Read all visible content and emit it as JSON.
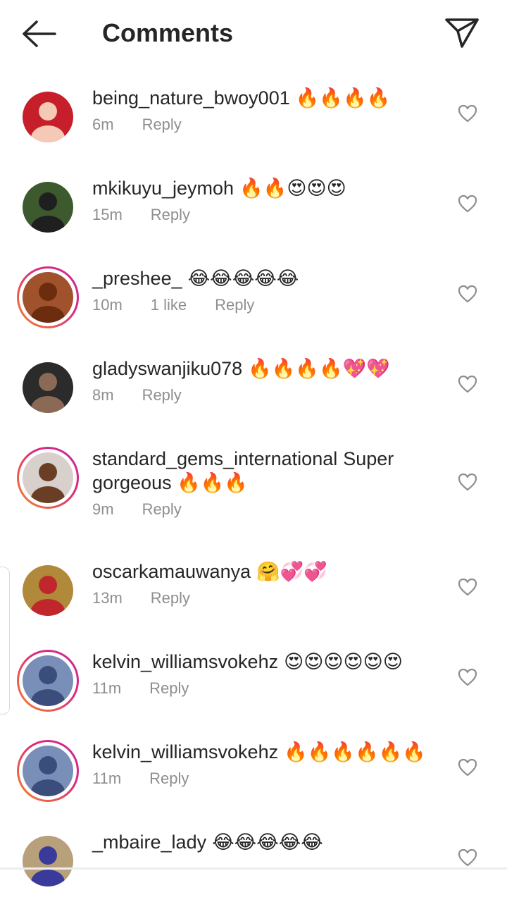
{
  "header": {
    "title": "Comments",
    "back_icon": "arrow-left-icon",
    "share_icon": "paper-plane-icon"
  },
  "comments": [
    {
      "username": "being_nature_bwoy001",
      "text": "🔥🔥🔥🔥",
      "time": "6m",
      "likes": "",
      "reply": "Reply",
      "story_ring": false,
      "avatar_colors": [
        "#c71e2b",
        "#f5c9b5"
      ]
    },
    {
      "username": "mkikuyu_jeymoh",
      "text": "🔥🔥😍😍😍",
      "time": "15m",
      "likes": "",
      "reply": "Reply",
      "story_ring": false,
      "avatar_colors": [
        "#3d5a2f",
        "#1f1f1f"
      ]
    },
    {
      "username": "_preshee_",
      "text": "😂😂😂😂😂",
      "time": "10m",
      "likes": "1 like",
      "reply": "Reply",
      "story_ring": true,
      "avatar_colors": [
        "#a0522d",
        "#6b2d0e"
      ]
    },
    {
      "username": "gladyswanjiku078",
      "text": "🔥🔥🔥🔥💖💖",
      "time": "8m",
      "likes": "",
      "reply": "Reply",
      "story_ring": false,
      "avatar_colors": [
        "#2b2b2b",
        "#8b6a55"
      ]
    },
    {
      "username": "standard_gems_international",
      "text": "Super gorgeous 🔥🔥🔥",
      "time": "9m",
      "likes": "",
      "reply": "Reply",
      "story_ring": true,
      "avatar_colors": [
        "#d8d0cc",
        "#6a3e25"
      ]
    },
    {
      "username": "oscarkamauwanya",
      "text": "🤗💞💞",
      "time": "13m",
      "likes": "",
      "reply": "Reply",
      "story_ring": false,
      "avatar_colors": [
        "#b08a3a",
        "#c0262c"
      ]
    },
    {
      "username": "kelvin_williamsvokehz",
      "text": "😍😍😍😍😍😍",
      "time": "11m",
      "likes": "",
      "reply": "Reply",
      "story_ring": true,
      "avatar_colors": [
        "#7a8fb8",
        "#3b4d7a"
      ]
    },
    {
      "username": "kelvin_williamsvokehz",
      "text": "🔥🔥🔥🔥🔥🔥",
      "time": "11m",
      "likes": "",
      "reply": "Reply",
      "story_ring": true,
      "avatar_colors": [
        "#7a8fb8",
        "#3b4d7a"
      ]
    },
    {
      "username": "_mbaire_lady",
      "text": "😂😂😂😂😂",
      "time": "",
      "likes": "",
      "reply": "",
      "story_ring": false,
      "avatar_colors": [
        "#b8a07a",
        "#3a3a9a"
      ]
    }
  ]
}
